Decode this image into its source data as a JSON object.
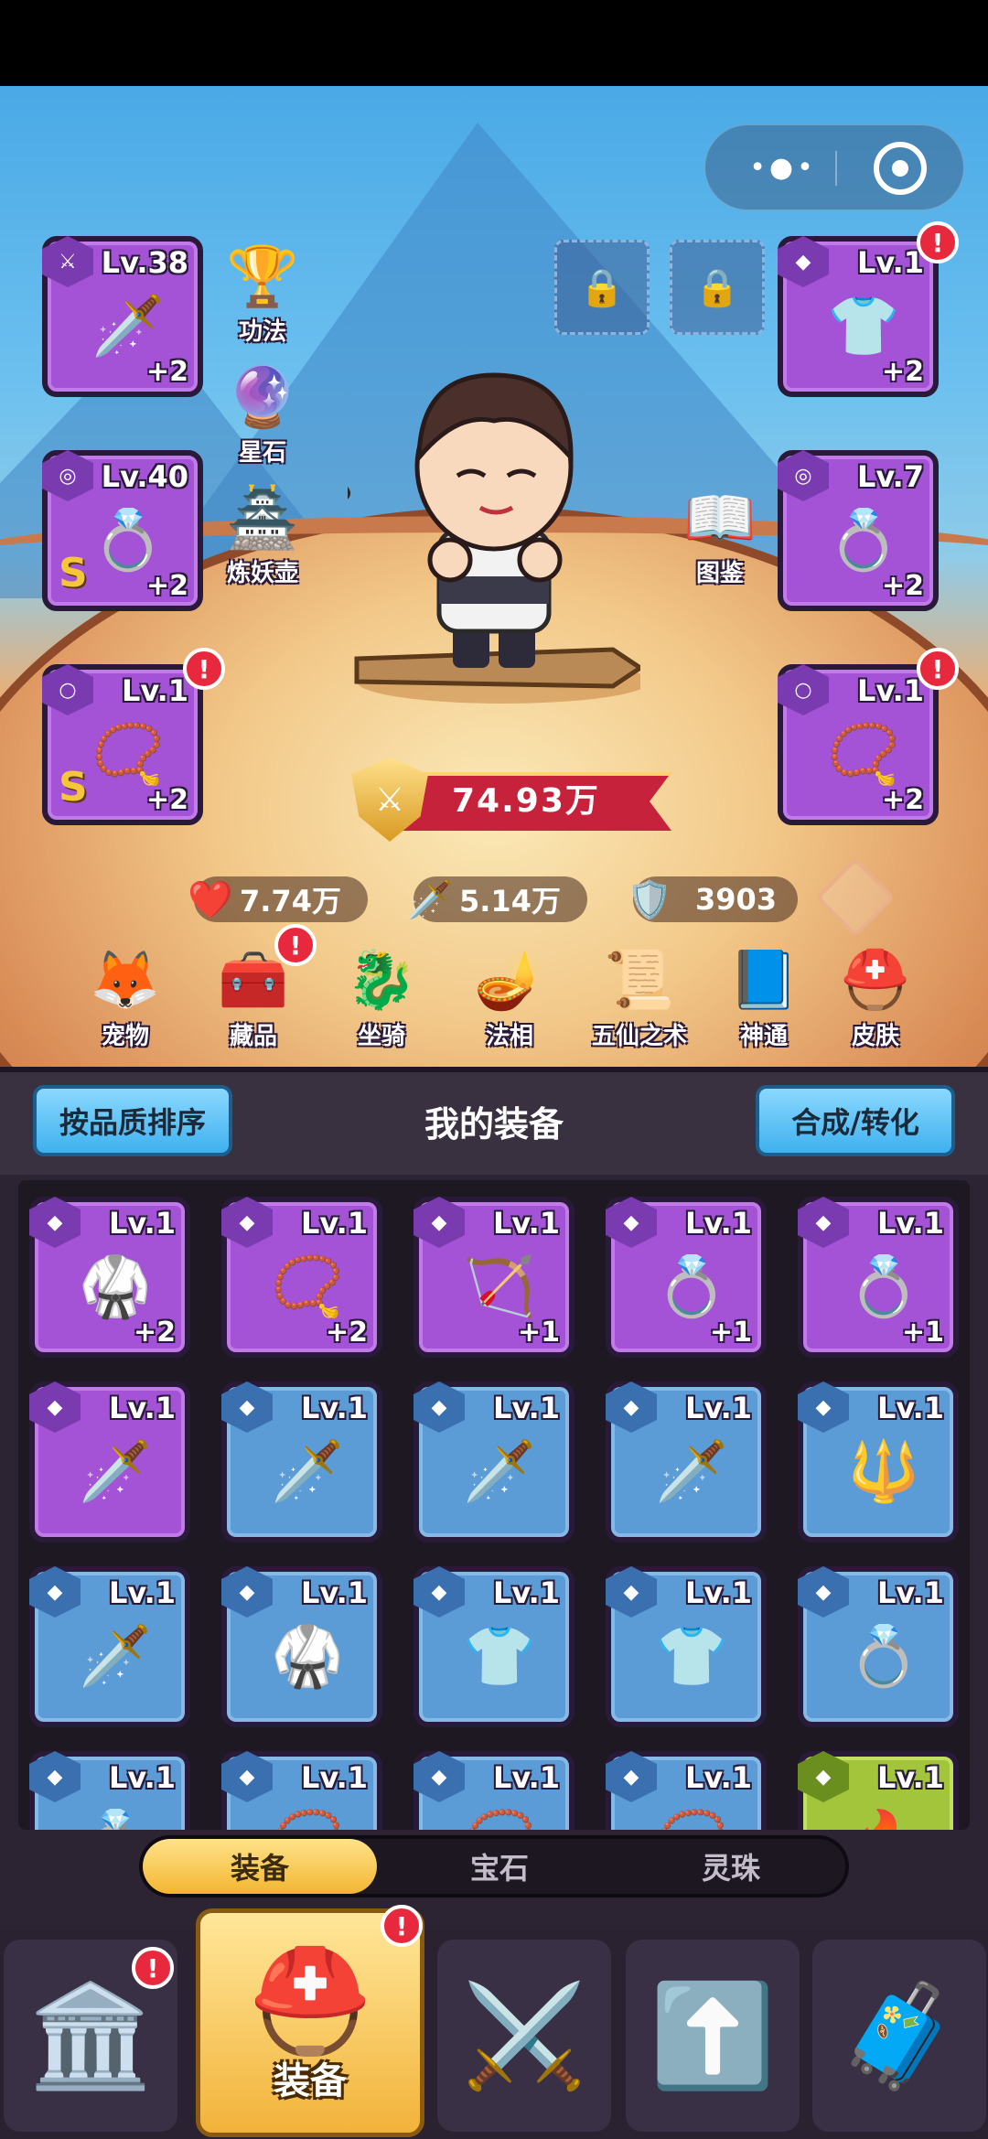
{
  "hero_equipment": {
    "left": [
      {
        "lv": "Lv.38",
        "plus": "+2",
        "s": "",
        "icon": "🗡️",
        "badge": ""
      },
      {
        "lv": "Lv.40",
        "plus": "+2",
        "s": "S",
        "icon": "💍",
        "badge": ""
      },
      {
        "lv": "Lv.1",
        "plus": "+2",
        "s": "S",
        "icon": "📿",
        "badge": "!"
      }
    ],
    "right": [
      {
        "lv": "Lv.1",
        "plus": "+2",
        "icon": "👕",
        "badge": "!"
      },
      {
        "lv": "Lv.7",
        "plus": "+2",
        "icon": "💍",
        "badge": ""
      },
      {
        "lv": "Lv.1",
        "plus": "+2",
        "icon": "📿",
        "badge": "!"
      }
    ]
  },
  "side_left": [
    {
      "label": "功法",
      "icon": "🏆"
    },
    {
      "label": "星石",
      "icon": "🔮"
    },
    {
      "label": "炼妖壶",
      "icon": "🏯"
    }
  ],
  "side_right": [
    {
      "label": "图鉴",
      "icon": "📖"
    }
  ],
  "power": {
    "value": "74.93万"
  },
  "stats": {
    "hp": "7.74万",
    "atk": "5.14万",
    "def": "3903"
  },
  "features": [
    {
      "label": "宠物",
      "icon": "🦊",
      "badge": ""
    },
    {
      "label": "藏品",
      "icon": "🧰",
      "badge": "!"
    },
    {
      "label": "坐骑",
      "icon": "🐉",
      "badge": ""
    },
    {
      "label": "法相",
      "icon": "🪔",
      "badge": ""
    },
    {
      "label": "五仙之术",
      "icon": "📜",
      "badge": ""
    },
    {
      "label": "神通",
      "icon": "📘",
      "badge": ""
    },
    {
      "label": "皮肤",
      "icon": "⛑️",
      "badge": ""
    }
  ],
  "panel": {
    "sort_button": "按品质排序",
    "title": "我的装备",
    "combine_button": "合成/转化"
  },
  "inventory": [
    {
      "lv": "Lv.1",
      "plus": "+2",
      "icon": "🥋",
      "tier": "purple"
    },
    {
      "lv": "Lv.1",
      "plus": "+2",
      "icon": "📿",
      "tier": "purple"
    },
    {
      "lv": "Lv.1",
      "plus": "+1",
      "icon": "🏹",
      "tier": "purple"
    },
    {
      "lv": "Lv.1",
      "plus": "+1",
      "icon": "💍",
      "tier": "purple"
    },
    {
      "lv": "Lv.1",
      "plus": "+1",
      "icon": "💍",
      "tier": "purple"
    },
    {
      "lv": "Lv.1",
      "plus": "",
      "icon": "🗡️",
      "tier": "purple"
    },
    {
      "lv": "Lv.1",
      "plus": "",
      "icon": "🗡️",
      "tier": "blue"
    },
    {
      "lv": "Lv.1",
      "plus": "",
      "icon": "🗡️",
      "tier": "blue"
    },
    {
      "lv": "Lv.1",
      "plus": "",
      "icon": "🗡️",
      "tier": "blue"
    },
    {
      "lv": "Lv.1",
      "plus": "",
      "icon": "🔱",
      "tier": "blue"
    },
    {
      "lv": "Lv.1",
      "plus": "",
      "icon": "🗡️",
      "tier": "blue"
    },
    {
      "lv": "Lv.1",
      "plus": "",
      "icon": "🥋",
      "tier": "blue"
    },
    {
      "lv": "Lv.1",
      "plus": "",
      "icon": "👕",
      "tier": "blue"
    },
    {
      "lv": "Lv.1",
      "plus": "",
      "icon": "👕",
      "tier": "blue"
    },
    {
      "lv": "Lv.1",
      "plus": "",
      "icon": "💍",
      "tier": "blue"
    },
    {
      "lv": "Lv.1",
      "plus": "",
      "icon": "💍",
      "tier": "blue"
    },
    {
      "lv": "Lv.1",
      "plus": "",
      "icon": "📿",
      "tier": "blue"
    },
    {
      "lv": "Lv.1",
      "plus": "",
      "icon": "📿",
      "tier": "blue"
    },
    {
      "lv": "Lv.1",
      "plus": "",
      "icon": "📿",
      "tier": "blue"
    },
    {
      "lv": "Lv.1",
      "plus": "",
      "icon": "🔥",
      "tier": "green"
    }
  ],
  "tabs": [
    {
      "label": "装备",
      "active": true
    },
    {
      "label": "宝石",
      "active": false
    },
    {
      "label": "灵珠",
      "active": false
    }
  ],
  "nav": [
    {
      "icon": "🏛️",
      "label": "",
      "badge": "!"
    },
    {
      "icon": "⛑️",
      "label": "装备",
      "badge": "!"
    },
    {
      "icon": "⚔️",
      "label": "",
      "badge": ""
    },
    {
      "icon": "⬆️",
      "label": "",
      "badge": ""
    },
    {
      "icon": "🧳",
      "label": "",
      "badge": ""
    }
  ]
}
